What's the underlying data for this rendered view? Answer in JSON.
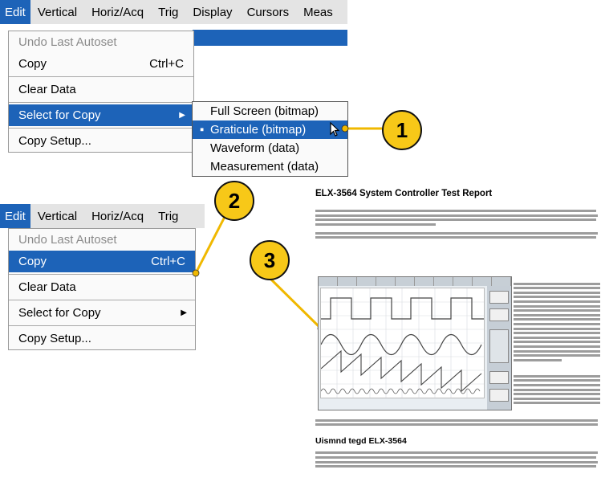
{
  "menu_top": {
    "menubar": [
      "Edit",
      "Vertical",
      "Horiz/Acq",
      "Trig",
      "Display",
      "Cursors",
      "Meas"
    ],
    "items": [
      {
        "label": "Undo Last Autoset",
        "shortcut": "",
        "state": "disabled"
      },
      {
        "label": "Copy",
        "shortcut": "Ctrl+C",
        "state": "normal"
      },
      {
        "label": "Clear Data",
        "shortcut": "",
        "state": "normal"
      },
      {
        "label": "Select for Copy",
        "shortcut": "",
        "state": "selected"
      },
      {
        "label": "Copy Setup...",
        "shortcut": "",
        "state": "normal"
      }
    ],
    "submenu": [
      "Full Screen (bitmap)",
      "Graticule (bitmap)",
      "Waveform (data)",
      "Measurement (data)"
    ]
  },
  "menu_bottom": {
    "menubar": [
      "Edit",
      "Vertical",
      "Horiz/Acq",
      "Trig"
    ],
    "items": [
      {
        "label": "Undo Last Autoset",
        "shortcut": "",
        "state": "disabled"
      },
      {
        "label": "Copy",
        "shortcut": "Ctrl+C",
        "state": "selected"
      },
      {
        "label": "Clear Data",
        "shortcut": "",
        "state": "normal"
      },
      {
        "label": "Select for Copy",
        "shortcut": "",
        "state": "normal"
      },
      {
        "label": "Copy Setup...",
        "shortcut": "",
        "state": "normal"
      }
    ]
  },
  "callouts": [
    "1",
    "2",
    "3"
  ],
  "report": {
    "title": "ELX-3564 System Controller Test Report",
    "subheading": "Uismnd tegd ELX-3564"
  },
  "colors": {
    "highlight": "#1d63b8",
    "callout": "#f7c818",
    "menubar": "#e4e4e4"
  }
}
